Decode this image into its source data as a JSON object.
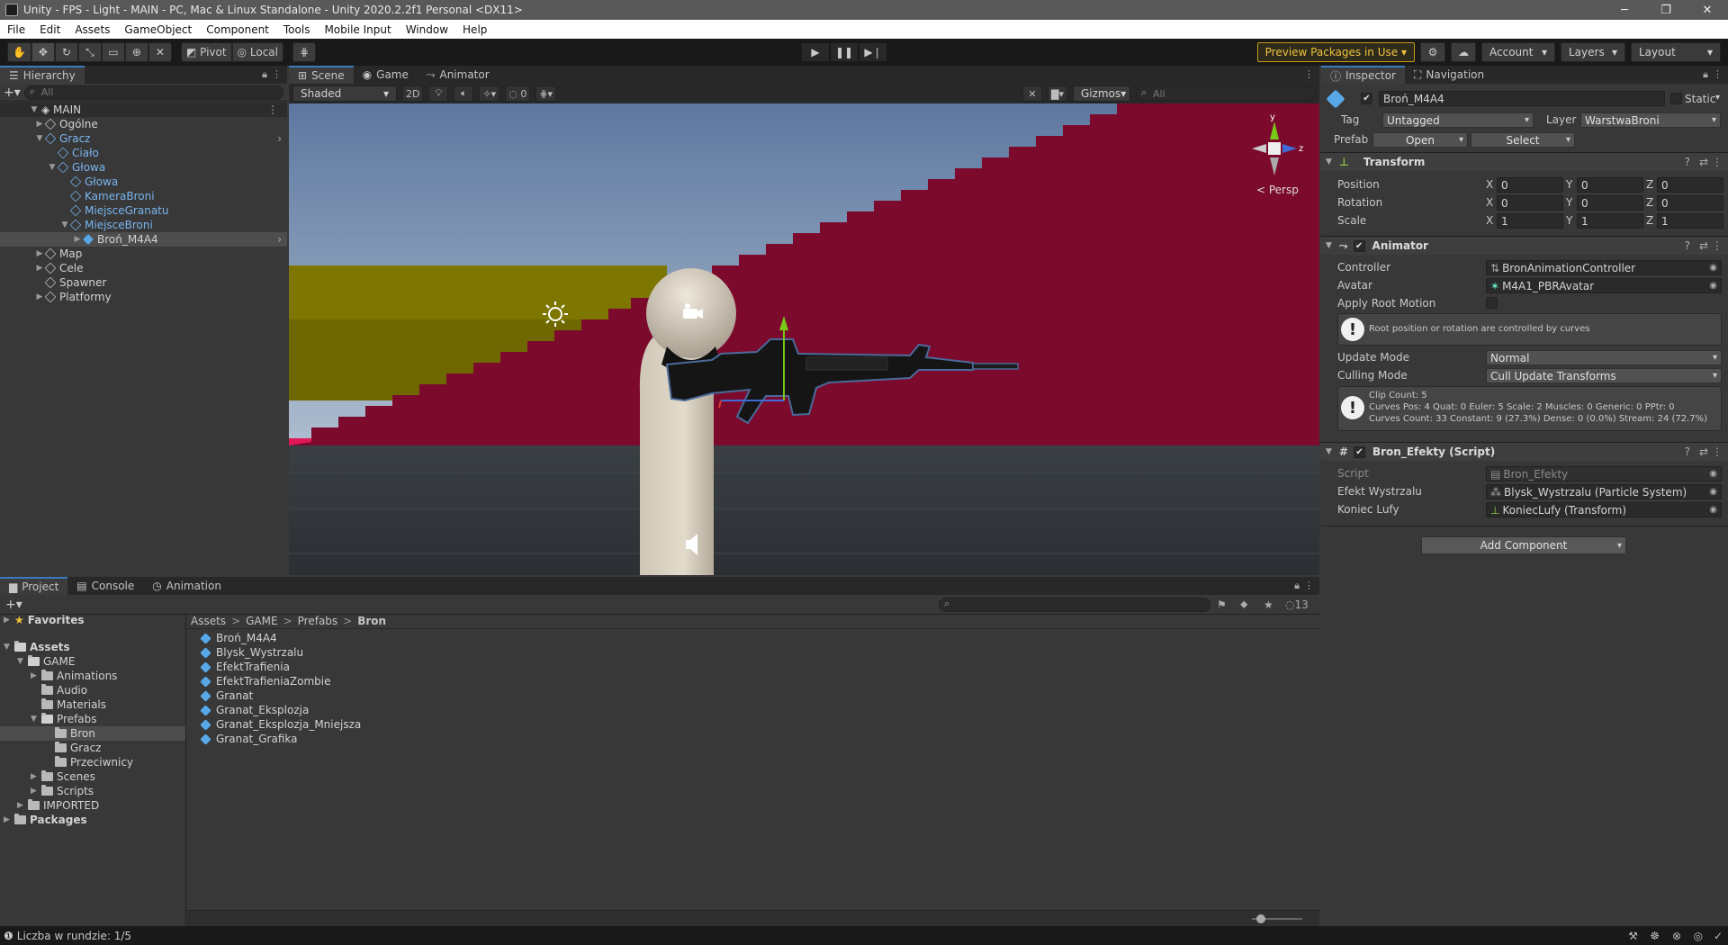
{
  "window": {
    "title": "Unity - FPS - Light - MAIN - PC, Mac & Linux Standalone - Unity 2020.2.2f1 Personal <DX11>",
    "controls": [
      "─",
      "❐",
      "✕"
    ]
  },
  "menu": [
    "File",
    "Edit",
    "Assets",
    "GameObject",
    "Component",
    "Tools",
    "Mobile Input",
    "Window",
    "Help"
  ],
  "toolbar": {
    "pivot": "Pivot",
    "local": "Local",
    "preview_packages": "Preview Packages in Use",
    "account": "Account",
    "layers": "Layers",
    "layout": "Layout"
  },
  "hierarchy": {
    "tab": "Hierarchy",
    "search_placeholder": "All",
    "root": "MAIN",
    "items": [
      {
        "label": "Ogólne",
        "depth": 1,
        "arrow": "▶",
        "blue": false
      },
      {
        "label": "Gracz",
        "depth": 1,
        "arrow": "▼",
        "blue": true
      },
      {
        "label": "Ciało",
        "depth": 2,
        "arrow": "",
        "blue": true
      },
      {
        "label": "Głowa",
        "depth": 2,
        "arrow": "▼",
        "blue": true
      },
      {
        "label": "Głowa",
        "depth": 3,
        "arrow": "",
        "blue": true
      },
      {
        "label": "KameraBroni",
        "depth": 3,
        "arrow": "",
        "blue": true
      },
      {
        "label": "MiejsceGranatu",
        "depth": 3,
        "arrow": "",
        "blue": true
      },
      {
        "label": "MiejsceBroni",
        "depth": 3,
        "arrow": "▼",
        "blue": true
      },
      {
        "label": "Broń_M4A4",
        "depth": 4,
        "arrow": "▶",
        "blue": false,
        "selected": true
      },
      {
        "label": "Map",
        "depth": 1,
        "arrow": "▶",
        "blue": false
      },
      {
        "label": "Cele",
        "depth": 1,
        "arrow": "▶",
        "blue": false
      },
      {
        "label": "Spawner",
        "depth": 1,
        "arrow": "",
        "blue": false
      },
      {
        "label": "Platformy",
        "depth": 1,
        "arrow": "▶",
        "blue": false
      }
    ]
  },
  "scene": {
    "tabs": [
      "Scene",
      "Game",
      "Animator"
    ],
    "shading": "Shaded",
    "mode_2d": "2D",
    "hidden_count": "0",
    "gizmos": "Gizmos",
    "search_placeholder": "All",
    "persp": "Persp",
    "axis_y": "y",
    "axis_z": "z"
  },
  "inspector": {
    "tabs": [
      "Inspector",
      "Navigation"
    ],
    "object_name": "Broń_M4A4",
    "static": "Static",
    "tag_label": "Tag",
    "tag_value": "Untagged",
    "layer_label": "Layer",
    "layer_value": "WarstwaBroni",
    "prefab_label": "Prefab",
    "prefab_open": "Open",
    "prefab_select": "Select",
    "transform": {
      "title": "Transform",
      "rows": [
        {
          "label": "Position",
          "x": "0",
          "y": "0",
          "z": "0"
        },
        {
          "label": "Rotation",
          "x": "0",
          "y": "0",
          "z": "0"
        },
        {
          "label": "Scale",
          "x": "1",
          "y": "1",
          "z": "1"
        }
      ]
    },
    "animator": {
      "title": "Animator",
      "controller_label": "Controller",
      "controller_value": "BronAnimationController",
      "avatar_label": "Avatar",
      "avatar_value": "M4A1_PBRAvatar",
      "root_motion_label": "Apply Root Motion",
      "root_motion_note": "Root position or rotation are controlled by curves",
      "update_mode_label": "Update Mode",
      "update_mode_value": "Normal",
      "culling_label": "Culling Mode",
      "culling_value": "Cull Update Transforms",
      "clip_info": [
        "Clip Count: 5",
        "Curves Pos: 4 Quat: 0 Euler: 5 Scale: 2 Muscles: 0 Generic: 0 PPtr: 0",
        "Curves Count: 33 Constant: 9 (27.3%) Dense: 0 (0.0%) Stream: 24 (72.7%)"
      ]
    },
    "script": {
      "title": "Bron_Efekty (Script)",
      "script_label": "Script",
      "script_value": "Bron_Efekty",
      "efekt_label": "Efekt Wystrzalu",
      "efekt_value": "Blysk_Wystrzalu (Particle System)",
      "koniec_label": "Koniec Lufy",
      "koniec_value": "KoniecLufy (Transform)"
    },
    "add_component": "Add Component"
  },
  "project": {
    "tabs": [
      "Project",
      "Console",
      "Animation"
    ],
    "hidden_count": "13",
    "favorites": "Favorites",
    "tree": [
      {
        "label": "Assets",
        "depth": 0,
        "arrow": "▼",
        "bold": true
      },
      {
        "label": "GAME",
        "depth": 1,
        "arrow": "▼"
      },
      {
        "label": "Animations",
        "depth": 2,
        "arrow": "▶"
      },
      {
        "label": "Audio",
        "depth": 2,
        "arrow": ""
      },
      {
        "label": "Materials",
        "depth": 2,
        "arrow": ""
      },
      {
        "label": "Prefabs",
        "depth": 2,
        "arrow": "▼"
      },
      {
        "label": "Bron",
        "depth": 3,
        "arrow": "",
        "selected": true
      },
      {
        "label": "Gracz",
        "depth": 3,
        "arrow": ""
      },
      {
        "label": "Przeciwnicy",
        "depth": 3,
        "arrow": ""
      },
      {
        "label": "Scenes",
        "depth": 2,
        "arrow": "▶"
      },
      {
        "label": "Scripts",
        "depth": 2,
        "arrow": "▶"
      },
      {
        "label": "IMPORTED",
        "depth": 1,
        "arrow": "▶"
      },
      {
        "label": "Packages",
        "depth": 0,
        "arrow": "▶",
        "bold": true
      }
    ],
    "breadcrumb": [
      "Assets",
      "GAME",
      "Prefabs",
      "Bron"
    ],
    "assets": [
      "Broń_M4A4",
      "Blysk_Wystrzalu",
      "EfektTrafienia",
      "EfektTrafieniaZombie",
      "Granat",
      "Granat_Eksplozja",
      "Granat_Eksplozja_Mniejsza",
      "Granat_Grafika"
    ]
  },
  "status": {
    "text": "Liczba w rundzie: 1/5"
  },
  "colors": {
    "accent": "#3a79bb",
    "prefab_blue": "#58a8e8",
    "preview_border": "#c89b12",
    "wall_red": "#7a0a2a",
    "sky": "#6f88a8"
  }
}
